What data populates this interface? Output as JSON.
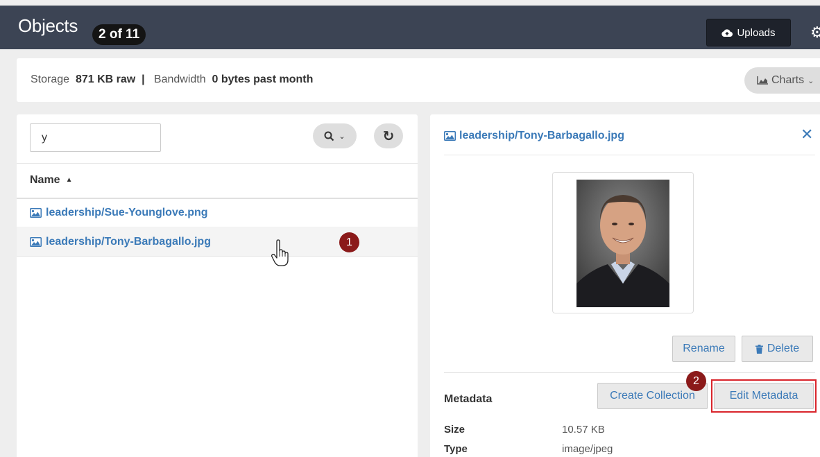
{
  "header": {
    "title": "Objects",
    "count_badge": "2 of 11",
    "uploads_label": "Uploads"
  },
  "storage": {
    "storage_label": "Storage",
    "storage_value": "871 KB raw",
    "separator": "|",
    "bandwidth_label": "Bandwidth",
    "bandwidth_value": "0 bytes past month",
    "charts_label": "Charts"
  },
  "search": {
    "value": "y"
  },
  "table": {
    "name_header": "Name",
    "rows": [
      {
        "name": "leadership/Sue-Younglove.png"
      },
      {
        "name": "leadership/Tony-Barbagallo.jpg"
      }
    ]
  },
  "annotations": {
    "step1": "1",
    "step2": "2"
  },
  "detail": {
    "title": "leadership/Tony-Barbagallo.jpg",
    "rename_label": "Rename",
    "delete_label": "Delete",
    "metadata_label": "Metadata",
    "create_collection_label": "Create Collection",
    "edit_metadata_label": "Edit Metadata",
    "fields": [
      {
        "key": "Size",
        "value": "10.57 KB"
      },
      {
        "key": "Type",
        "value": "image/jpeg"
      }
    ]
  },
  "colors": {
    "header_bg": "#3c4454",
    "link": "#3b7ab8",
    "step_badge": "#8b1a1a",
    "highlight": "#d9242b"
  }
}
